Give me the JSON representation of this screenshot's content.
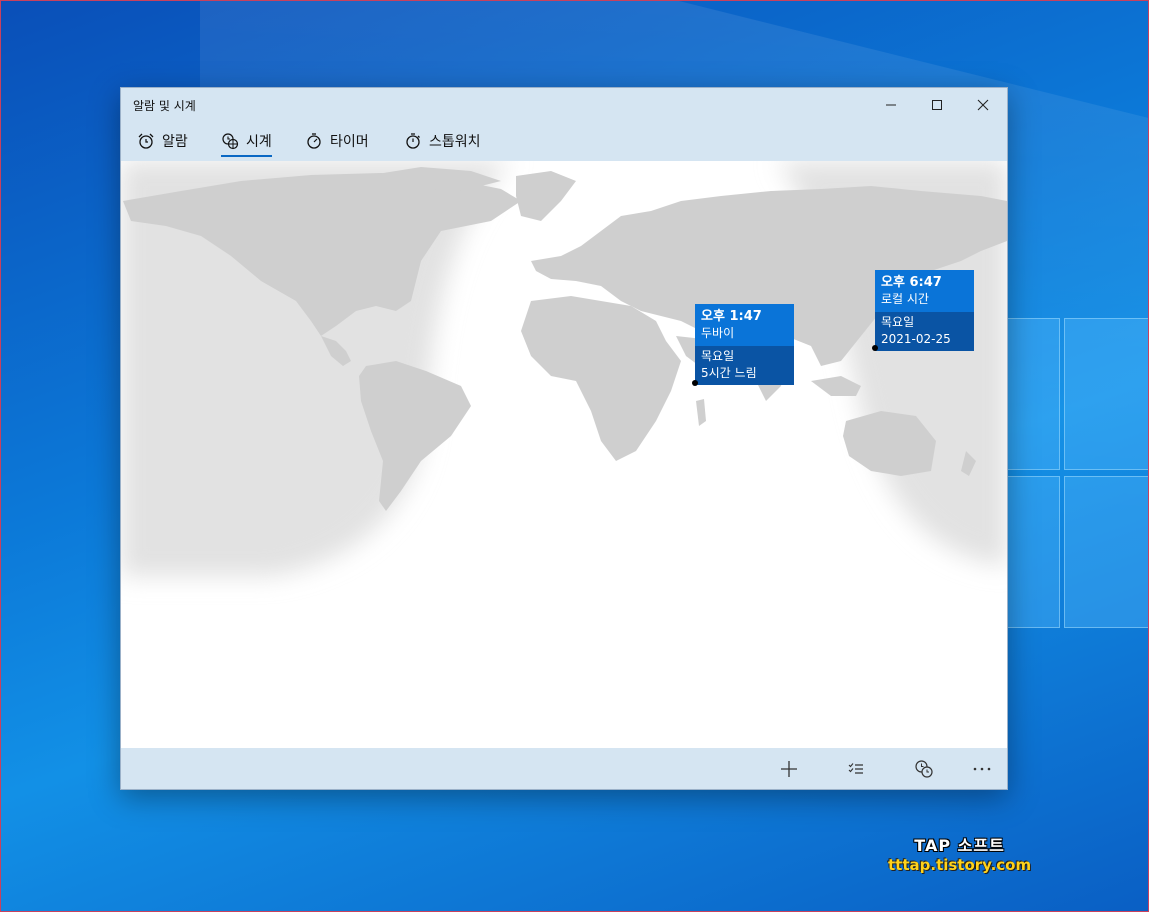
{
  "window": {
    "title": "알람 및 시계"
  },
  "tabs": [
    {
      "label": "알람",
      "icon": "alarm-clock-icon"
    },
    {
      "label": "시계",
      "icon": "world-clock-icon",
      "selected": true
    },
    {
      "label": "타이머",
      "icon": "timer-icon"
    },
    {
      "label": "스톱워치",
      "icon": "stopwatch-icon"
    }
  ],
  "cities": [
    {
      "time": "오후 1:47",
      "name": "두바이",
      "day": "목요일",
      "offset": "5시간 느림"
    },
    {
      "time": "오후 6:47",
      "name": "로컬 시간",
      "day": "목요일",
      "date": "2021-02-25"
    }
  ],
  "commands": [
    {
      "icon": "add-icon"
    },
    {
      "icon": "select-list-icon"
    },
    {
      "icon": "compare-clocks-icon"
    },
    {
      "icon": "more-icon"
    }
  ],
  "watermark": {
    "title": "TAP 소프트",
    "url": "tttap.tistory.com"
  },
  "colors": {
    "accent": "#0a74d8",
    "card_dark": "#0a54a4",
    "chrome": "#d5e5f2",
    "land": "#cfcfcf",
    "night": "#e4e4e4"
  }
}
